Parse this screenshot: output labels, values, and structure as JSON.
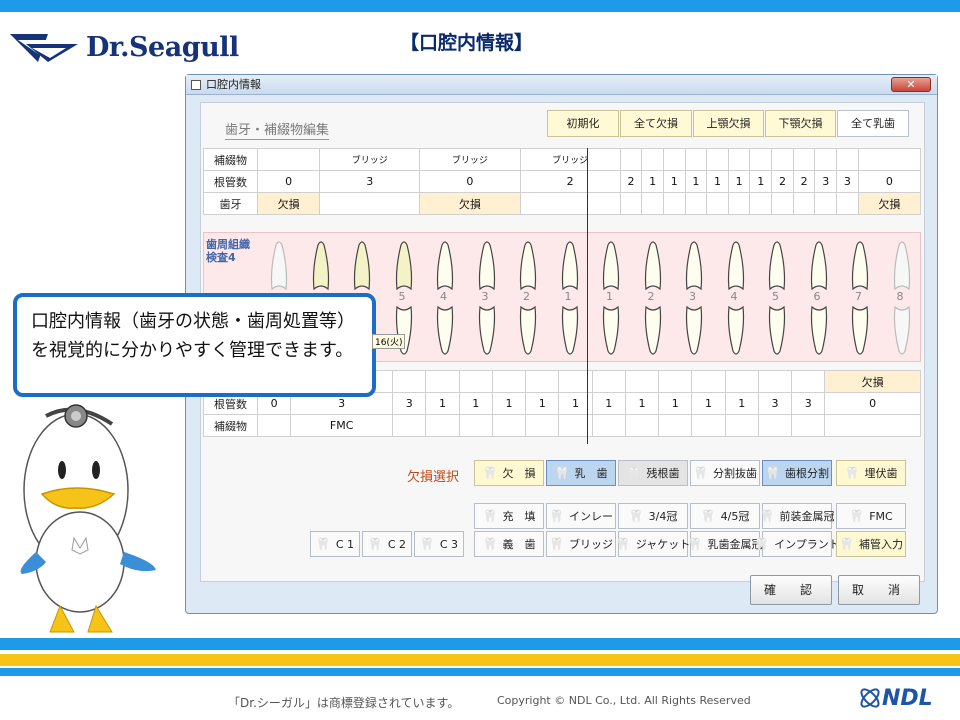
{
  "slide": {
    "brand": "Dr.Seagull",
    "title": "【口腔内情報】",
    "callout": "口腔内情報（歯牙の状態・歯周処置等）を視覚的に分かりやすく管理できます。",
    "footer_tm": "「Dr.シーガル」は商標登録されています。",
    "footer_copy": "Copyright © NDL Co., Ltd. All Rights Reserved",
    "ndl": "NDL",
    "colors": {
      "accent_blue": "#1e9be8",
      "accent_yellow": "#f6c419",
      "navy": "#16337a"
    }
  },
  "window": {
    "title": "口腔内情報",
    "close_icon": "close-icon",
    "section_label": "歯牙・補綴物編集",
    "top_buttons": [
      "初期化",
      "全て欠損",
      "上顎欠損",
      "下顎欠損",
      "全て乳歯"
    ]
  },
  "upper": {
    "rows": [
      {
        "label": "補綴物",
        "cells": [
          "",
          "ブリッジ",
          "ブリッジ",
          "ブリッジ",
          "",
          "",
          "",
          "",
          "",
          "",
          "",
          "",
          "",
          "",
          "",
          ""
        ]
      },
      {
        "label": "根管数",
        "cells": [
          "0",
          "3",
          "0",
          "2",
          "2",
          "1",
          "1",
          "1",
          "1",
          "1",
          "1",
          "2",
          "2",
          "3",
          "3",
          "0"
        ]
      },
      {
        "label": "歯牙",
        "cells": [
          "欠損",
          "",
          "欠損",
          "",
          "",
          "",
          "",
          "",
          "",
          "",
          "",
          "",
          "",
          "",
          "",
          "欠損"
        ]
      }
    ]
  },
  "perio": {
    "label": "歯周組織検査4",
    "numbers": [
      "5",
      "4",
      "3",
      "2",
      "1",
      "1",
      "2",
      "3",
      "4",
      "5",
      "6",
      "7",
      "8"
    ],
    "date_tag": "16(火)"
  },
  "lower": {
    "rows": [
      {
        "label": "",
        "cells": [
          "",
          "",
          "",
          "",
          "",
          "",
          "",
          "",
          "",
          "",
          "",
          "",
          "",
          "",
          "",
          "欠損"
        ]
      },
      {
        "label": "根管数",
        "cells": [
          "0",
          "3",
          "3",
          "1",
          "1",
          "1",
          "1",
          "1",
          "1",
          "1",
          "1",
          "1",
          "1",
          "3",
          "3",
          "0"
        ]
      },
      {
        "label": "補綴物",
        "cells": [
          "",
          "FMC",
          "",
          "",
          "",
          "",
          "",
          "",
          "",
          "",
          "",
          "",
          "",
          "",
          "",
          ""
        ]
      }
    ]
  },
  "selection": {
    "label": "欠損選択",
    "row1": [
      {
        "label": "欠　損",
        "icon": "missing-tooth-icon",
        "style": "y"
      },
      {
        "label": "乳　歯",
        "icon": "baby-tooth-icon",
        "style": "sel"
      },
      {
        "label": "残根歯",
        "icon": "residual-root-icon",
        "style": "grey"
      },
      {
        "label": "分割抜歯",
        "icon": "split-extraction-icon",
        "style": ""
      },
      {
        "label": "歯根分割",
        "icon": "root-split-icon",
        "style": "sel"
      },
      {
        "label": "埋伏歯",
        "icon": "impacted-tooth-icon",
        "style": "y"
      }
    ],
    "row2": [
      {
        "label": "充　填",
        "icon": "filling-icon"
      },
      {
        "label": "インレー",
        "icon": "inlay-icon"
      },
      {
        "label": "3/4冠",
        "icon": "crown-34-icon"
      },
      {
        "label": "4/5冠",
        "icon": "crown-45-icon"
      },
      {
        "label": "前装金属冠",
        "icon": "veneer-crown-icon"
      },
      {
        "label": "FMC",
        "icon": "fmc-icon"
      }
    ],
    "row3": [
      {
        "label": "義　歯",
        "icon": "denture-icon"
      },
      {
        "label": "ブリッジ",
        "icon": "bridge-icon"
      },
      {
        "label": "ジャケット",
        "icon": "jacket-icon"
      },
      {
        "label": "乳歯金属冠",
        "icon": "baby-metal-crown-icon"
      },
      {
        "label": "インプラント",
        "icon": "implant-icon"
      },
      {
        "label": "補管入力",
        "icon": "lock-icon"
      }
    ],
    "caries": [
      "C 1",
      "C 2",
      "C 3"
    ]
  },
  "actions": {
    "confirm": "確　認",
    "cancel": "取　消"
  }
}
